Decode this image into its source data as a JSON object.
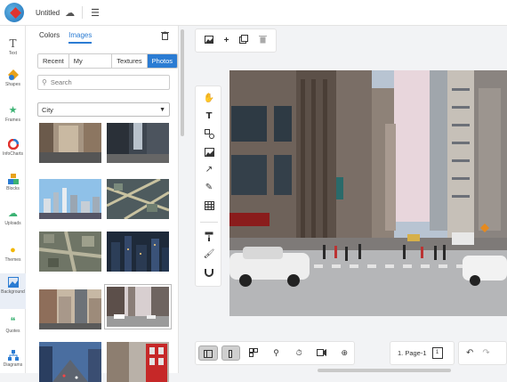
{
  "header": {
    "doc_title": "Untitled",
    "cloud_icon": "cloud-icon",
    "menu_icon": "hamburger-icon"
  },
  "rail": {
    "items": [
      {
        "label": "Text",
        "icon": "text-icon",
        "color": "#555555"
      },
      {
        "label": "Shapes",
        "icon": "shapes-icon",
        "color": "#e8a21c"
      },
      {
        "label": "Frames",
        "icon": "frames-icon",
        "color": "#3bb273"
      },
      {
        "label": "InfoCharts",
        "icon": "infocharts-icon",
        "color": "#e0332e"
      },
      {
        "label": "Blocks",
        "icon": "blocks-icon",
        "color": "#2b7cd3"
      },
      {
        "label": "Uploads",
        "icon": "upload-icon",
        "color": "#3bb273"
      },
      {
        "label": "Themes",
        "icon": "themes-icon",
        "color": "#f2b705"
      },
      {
        "label": "Background",
        "icon": "background-icon",
        "color": "#2b7cd3"
      },
      {
        "label": "Quotes",
        "icon": "quotes-icon",
        "color": "#3bb273"
      },
      {
        "label": "Diagrams",
        "icon": "diagrams-icon",
        "color": "#2b7cd3"
      }
    ],
    "active_index": 7
  },
  "panel": {
    "tabs": [
      "Colors",
      "Images"
    ],
    "active_tab": 1,
    "subtabs": [
      "Recent",
      "My Uploads",
      "Textures",
      "Photos"
    ],
    "active_subtab": 3,
    "search_placeholder": "Search",
    "category_selected": "City"
  },
  "toolbar_top": {
    "icons": [
      "image-icon",
      "plus-icon",
      "duplicate-icon",
      "delete-icon"
    ]
  },
  "toolbar_left": {
    "group1": [
      "hand-icon",
      "text-tool-icon",
      "shapes-tool-icon",
      "image-tool-icon",
      "arrow-icon",
      "pen-icon",
      "table-icon"
    ],
    "group2": [
      "paint-roller-icon",
      "brush-icon",
      "magnet-icon"
    ]
  },
  "bottombar": {
    "icons": [
      "panel-left-icon",
      "panel-right-icon",
      "grid-icon",
      "zoom-icon",
      "timer-icon",
      "video-icon",
      "zoom-fit-icon"
    ],
    "page_label": "1. Page-1",
    "page_number": "1"
  },
  "colors": {
    "accent": "#2b7cd3"
  }
}
